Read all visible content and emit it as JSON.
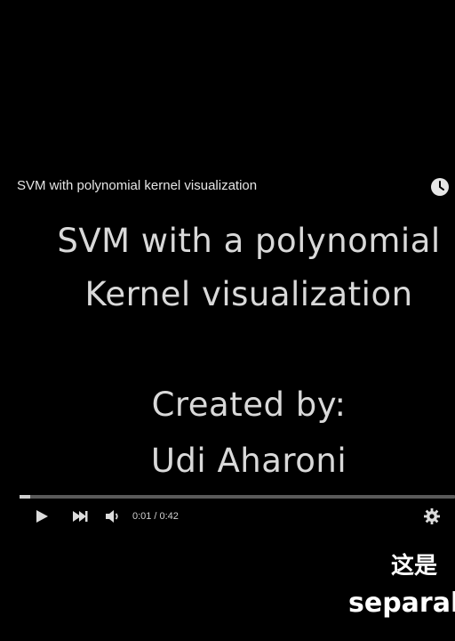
{
  "video": {
    "title": "SVM with polynomial kernel visualization"
  },
  "slide": {
    "line1": "SVM with a polynomial",
    "line2": "Kernel visualization",
    "line3": "Created by:",
    "line4": "Udi Aharoni"
  },
  "player": {
    "current_time": "0:01",
    "separator": "/",
    "duration": "0:42",
    "progress_fraction": 0.024
  },
  "overlay": {
    "subtitle_line1": "这是",
    "subtitle_line2": "separab"
  },
  "icons": {
    "watch_later": "clock-icon",
    "play": "play-icon",
    "next": "next-icon",
    "volume": "volume-icon",
    "settings": "gear-icon"
  }
}
